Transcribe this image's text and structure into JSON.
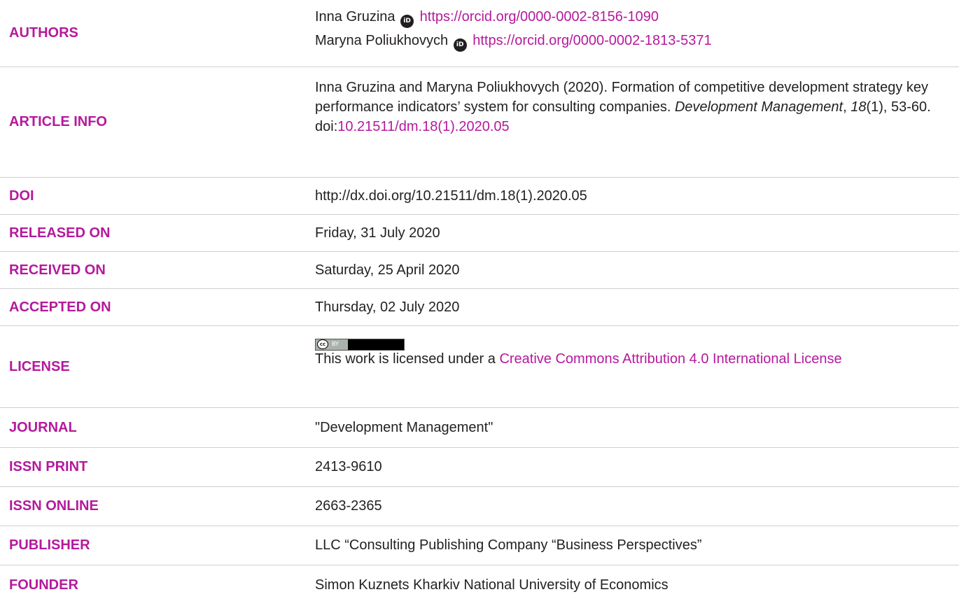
{
  "authors": {
    "label": "AUTHORS",
    "list": [
      {
        "name": "Inna Gruzina",
        "orcid": "https://orcid.org/0000-0002-8156-1090"
      },
      {
        "name": "Maryna Poliukhovych",
        "orcid": "https://orcid.org/0000-0002-1813-5371"
      }
    ],
    "orcid_icon_text": "iD"
  },
  "article_info": {
    "label": "ARTICLE INFO",
    "prefix": "Inna Gruzina and Maryna Poliukhovych (2020). Formation of competitive development strategy key performance indicators’ system for consulting companies. ",
    "journal_italic": "Development Management",
    "sep": ", ",
    "volume_italic": "18",
    "issue_pages": "(1), 53-60.",
    "doi_prefix": "doi:",
    "doi_link": "10.21511/dm.18(1).2020.05"
  },
  "doi": {
    "label": "DOI",
    "value": "http://dx.doi.org/10.21511/dm.18(1).2020.05"
  },
  "released": {
    "label": "RELEASED ON",
    "value": "Friday, 31 July 2020"
  },
  "received": {
    "label": "RECEIVED ON",
    "value": "Saturday, 25 April 2020"
  },
  "accepted": {
    "label": "ACCEPTED ON",
    "value": "Thursday, 02 July 2020"
  },
  "license": {
    "label": "LICENSE",
    "badge_cc": "cc",
    "badge_by": "BY",
    "text_prefix": "This work is licensed under a ",
    "link_text": "Creative Commons Attribution 4.0 International License"
  },
  "journal": {
    "label": "JOURNAL",
    "value": "\"Development Management\""
  },
  "issn_print": {
    "label": "ISSN PRINT",
    "value": "2413-9610"
  },
  "issn_online": {
    "label": "ISSN ONLINE",
    "value": "2663-2365"
  },
  "publisher": {
    "label": "PUBLISHER",
    "value": "LLC “Consulting Publishing Company “Business Perspectives”"
  },
  "founder": {
    "label": "FOUNDER",
    "value": "Simon Kuznets Kharkiv National University of Economics"
  },
  "colors": {
    "accent": "#b5199c",
    "text": "#231f20",
    "divider": "#cfcfcf"
  }
}
